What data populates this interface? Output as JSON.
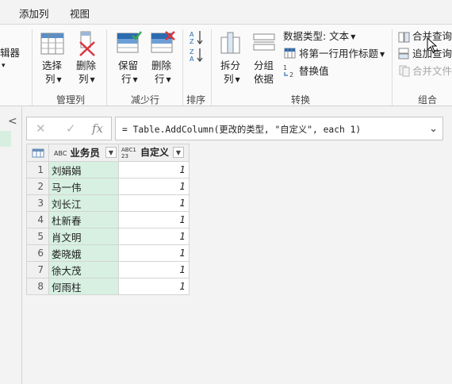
{
  "tabs": [
    "添加列",
    "视图"
  ],
  "ribbon": {
    "editor_fragment": "辑器",
    "choose_columns": [
      "选择",
      "列"
    ],
    "remove_columns": [
      "删除",
      "列"
    ],
    "keep_rows": [
      "保留",
      "行"
    ],
    "remove_rows": [
      "删除",
      "行"
    ],
    "split_column": [
      "拆分",
      "列"
    ],
    "group_by": [
      "分组",
      "依据"
    ],
    "data_type": "数据类型: 文本",
    "first_row_header": "将第一行用作标题",
    "replace_values": "替换值",
    "merge_queries": "合并查询",
    "append_queries": "追加查询",
    "combine_files": "合并文件",
    "groups": {
      "manage_columns": "管理列",
      "reduce_rows": "减少行",
      "sort": "排序",
      "transform": "转换",
      "combine": "组合"
    }
  },
  "formula": {
    "cancel": "✕",
    "confirm": "✓",
    "fx": "fx",
    "text": "= Table.AddColumn(更改的类型, \"自定义\", each 1)"
  },
  "table": {
    "columns": [
      {
        "type_icon": "ABC",
        "name": "业务员"
      },
      {
        "type_icon": "ABC123",
        "name": "自定义"
      }
    ],
    "rows": [
      {
        "n": "1",
        "name": "刘娟娟",
        "value": "1"
      },
      {
        "n": "2",
        "name": "马一伟",
        "value": "1"
      },
      {
        "n": "3",
        "name": "刘长江",
        "value": "1"
      },
      {
        "n": "4",
        "name": "杜新春",
        "value": "1"
      },
      {
        "n": "5",
        "name": "肖文明",
        "value": "1"
      },
      {
        "n": "6",
        "name": "娄晓娥",
        "value": "1"
      },
      {
        "n": "7",
        "name": "徐大茂",
        "value": "1"
      },
      {
        "n": "8",
        "name": "何雨柱",
        "value": "1"
      }
    ]
  },
  "colors": {
    "selected_column": "#d7f0e2",
    "ribbon_blue": "#2b6cb0",
    "ribbon_red": "#d9363e"
  }
}
